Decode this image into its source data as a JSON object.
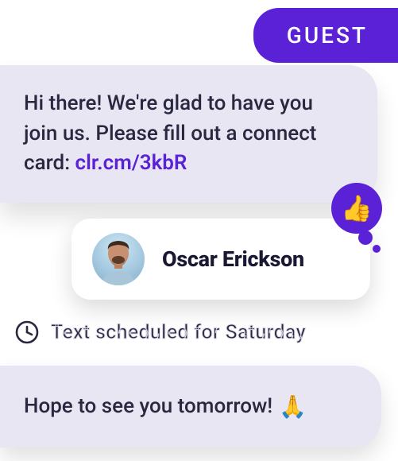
{
  "badge": {
    "label": "GUEST"
  },
  "message1": {
    "text_before": "Hi there! We're glad to have you join us. Please fill out a connect card: ",
    "link_text": "clr.cm/3kbR"
  },
  "reaction": {
    "emoji": "👍"
  },
  "contact": {
    "name": "Oscar Erickson"
  },
  "schedule": {
    "text": "Text scheduled for Saturday"
  },
  "message2": {
    "text": "Hope to see you tomorrow! ",
    "emoji": "🙏"
  }
}
